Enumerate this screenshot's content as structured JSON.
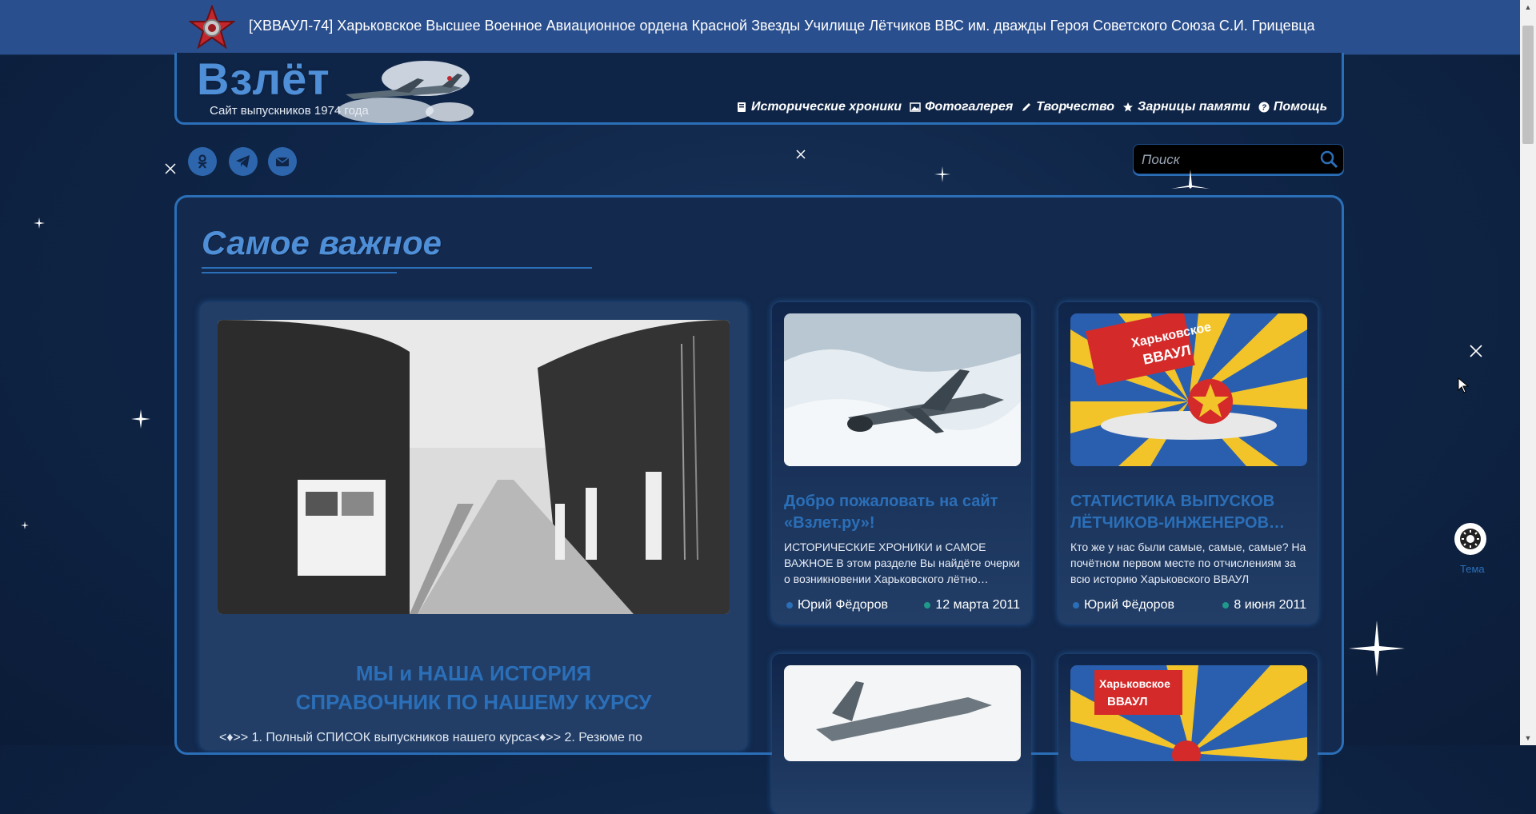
{
  "banner": {
    "title": "[ХВВАУЛ-74] Харьковское Высшее Военное Авиационное ордена Красной Звезды Училище Лётчиков ВВС им. дважды Героя Советского Союза С.И. Грицевца",
    "icon": "red-star-order-icon"
  },
  "header": {
    "logo": "Взлёт",
    "subtitle": "Сайт выпускников 1974 года"
  },
  "nav": {
    "items": [
      {
        "label": "Исторические хроники",
        "icon": "book-icon"
      },
      {
        "label": "Фотогалерея",
        "icon": "image-icon"
      },
      {
        "label": "Творчество",
        "icon": "pencil-icon"
      },
      {
        "label": "Зарницы памяти",
        "icon": "star-icon"
      },
      {
        "label": "Помощь",
        "icon": "question-icon"
      }
    ]
  },
  "social": {
    "items": [
      {
        "name": "odnoklassniki",
        "icon": "odnoklassniki-icon"
      },
      {
        "name": "telegram",
        "icon": "telegram-icon"
      },
      {
        "name": "email",
        "icon": "mail-icon"
      }
    ]
  },
  "search": {
    "placeholder": "Поиск",
    "icon": "search-icon"
  },
  "section": {
    "title": "Самое важное"
  },
  "featured": {
    "title_line1": "МЫ и НАША ИСТОРИЯ",
    "title_line2": "СПРАВОЧНИК ПО НАШЕМУ КУРСУ",
    "text": "<♦>> 1. Полный СПИСОК выпускников нашего курса<♦>> 2. Резюме по"
  },
  "cards": [
    {
      "title": "Добро пожаловать на сайт «Взлет.ру»!",
      "text": "ИСТОРИЧЕСКИЕ ХРОНИКИ и САМОЕ ВАЖНОЕ В этом разделе Вы найдёте очерки о возникновении Харьковского лётно…",
      "author": "Юрий Фёдоров",
      "date": "12 марта 2011"
    },
    {
      "title": "СТАТИСТИКА ВЫПУСКОВ ЛЁТЧИКОВ-ИНЖЕНЕРОВ…",
      "text": "Кто же у нас были самые, самые, самые? На почётном первом месте по отчислениям за всю историю Харьковского ВВАУЛ находится…",
      "author": "Юрий Фёдоров",
      "date": "8 июня 2011"
    }
  ],
  "card_banner_text": {
    "line1": "Харьковское",
    "line2": "ВВАУЛ"
  },
  "theme": {
    "label": "Тема",
    "icon": "sun-icon"
  },
  "colors": {
    "accent": "#2b6fb8",
    "banner": "#2a4f8e",
    "background": "#0f2547"
  }
}
